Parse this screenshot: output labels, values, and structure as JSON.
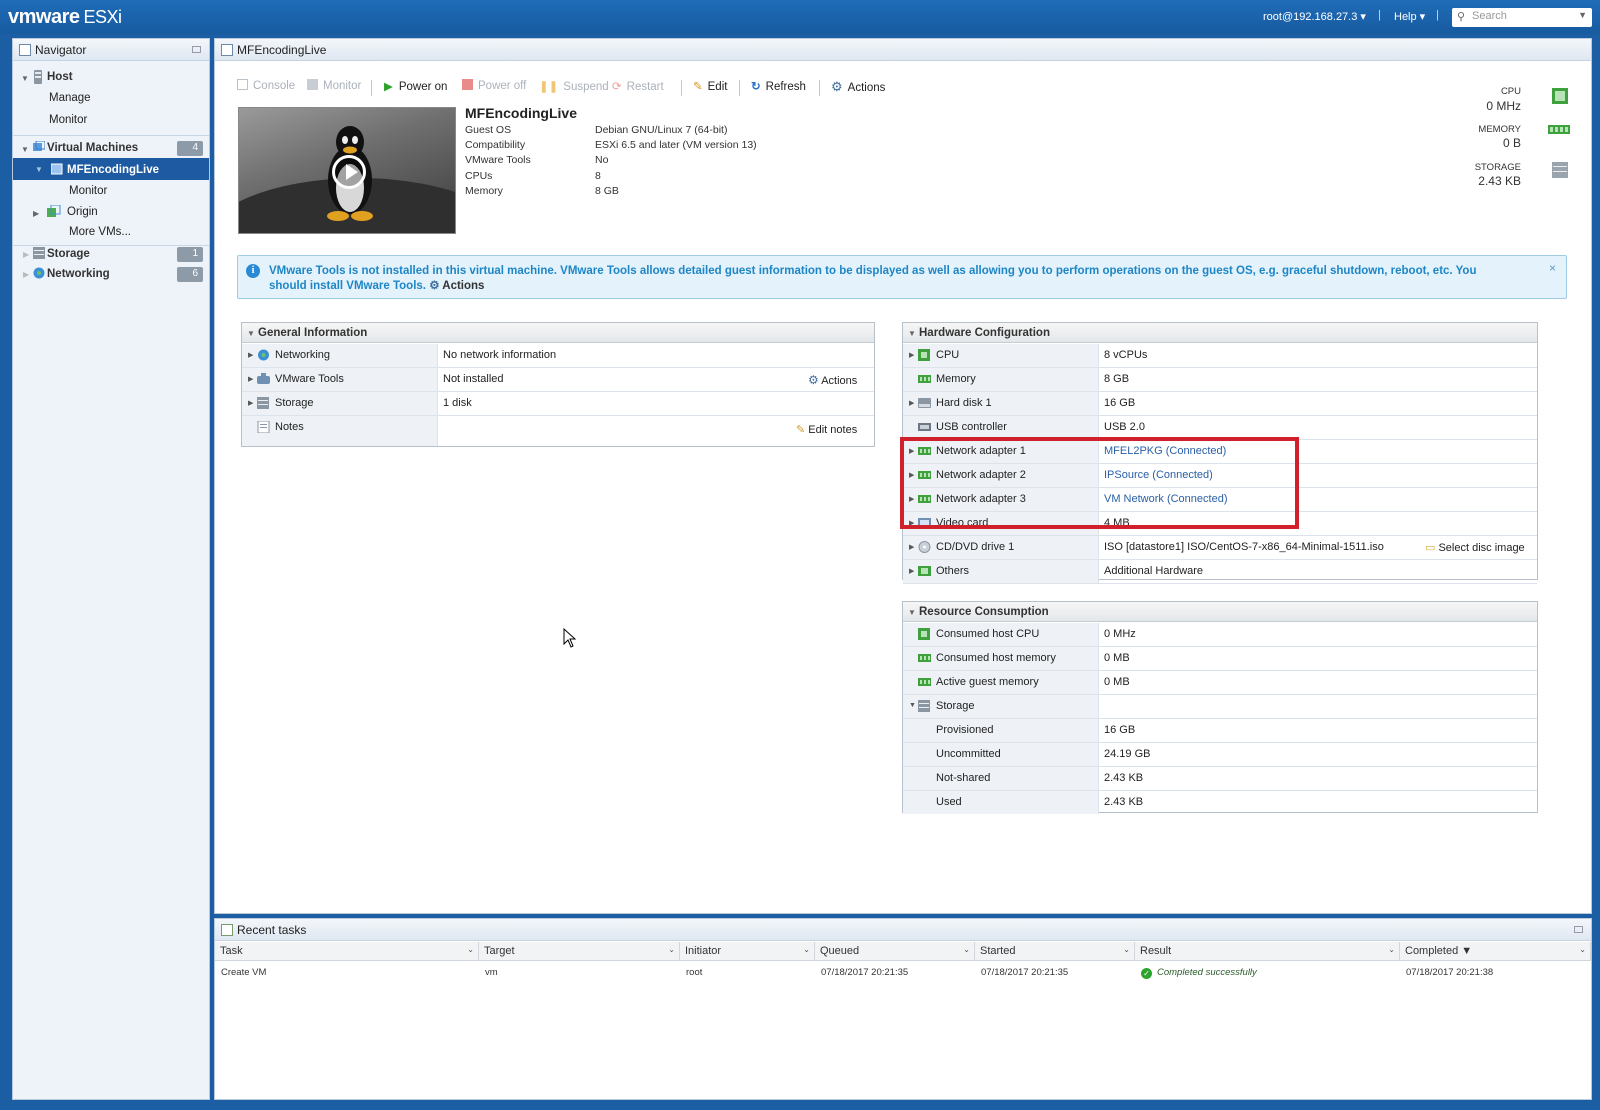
{
  "topbar": {
    "logo_vm": "vmware",
    "logo_product": "ESXi",
    "user": "root@192.168.27.3",
    "help": "Help",
    "search_placeholder": "Search"
  },
  "navigator": {
    "title": "Navigator",
    "host": "Host",
    "manage": "Manage",
    "monitor": "Monitor",
    "virtual_machines": "Virtual Machines",
    "vm_count": "4",
    "selected_vm": "MFEncodingLive",
    "vm_monitor": "Monitor",
    "origin": "Origin",
    "more_vms": "More VMs...",
    "storage": "Storage",
    "storage_count": "1",
    "networking": "Networking",
    "networking_count": "6"
  },
  "main": {
    "title": "MFEncodingLive",
    "toolbar": {
      "console": "Console",
      "monitor": "Monitor",
      "power_on": "Power on",
      "power_off": "Power off",
      "suspend": "Suspend",
      "restart": "Restart",
      "edit": "Edit",
      "refresh": "Refresh",
      "actions": "Actions"
    },
    "vm": {
      "name": "MFEncodingLive",
      "props": [
        {
          "label": "Guest OS",
          "value": "Debian GNU/Linux 7 (64-bit)"
        },
        {
          "label": "Compatibility",
          "value": "ESXi 6.5 and later (VM version 13)"
        },
        {
          "label": "VMware Tools",
          "value": "No"
        },
        {
          "label": "CPUs",
          "value": "8"
        },
        {
          "label": "Memory",
          "value": "8 GB"
        }
      ]
    },
    "stats": {
      "cpu_label": "CPU",
      "cpu_value": "0 MHz",
      "memory_label": "MEMORY",
      "memory_value": "0 B",
      "storage_label": "STORAGE",
      "storage_value": "2.43 KB"
    },
    "info": {
      "text": "VMware Tools is not installed in this virtual machine. VMware Tools allows detailed guest information to be displayed as well as allowing you to perform operations on the guest OS, e.g. graceful shutdown, reboot, etc. You should install VMware Tools.",
      "actions": "Actions",
      "close": "×"
    },
    "general": {
      "title": "General Information",
      "rows": [
        {
          "label": "Networking",
          "value": "No network information"
        },
        {
          "label": "VMware Tools",
          "value": "Not installed",
          "action": "Actions"
        },
        {
          "label": "Storage",
          "value": "1 disk"
        },
        {
          "label": "Notes",
          "value": "",
          "action": "Edit notes"
        }
      ]
    },
    "hardware": {
      "title": "Hardware Configuration",
      "rows": [
        {
          "label": "CPU",
          "value": "8 vCPUs"
        },
        {
          "label": "Memory",
          "value": "8 GB"
        },
        {
          "label": "Hard disk 1",
          "value": "16 GB"
        },
        {
          "label": "USB controller",
          "value": "USB 2.0"
        },
        {
          "label": "Network adapter 1",
          "value": "MFEL2PKG (Connected)"
        },
        {
          "label": "Network adapter 2",
          "value": "IPSource (Connected)"
        },
        {
          "label": "Network adapter 3",
          "value": "VM Network (Connected)"
        },
        {
          "label": "Video card",
          "value": "4 MB"
        },
        {
          "label": "CD/DVD drive 1",
          "value": "ISO [datastore1] ISO/CentOS-7-x86_64-Minimal-1511.iso",
          "action": "Select disc image"
        },
        {
          "label": "Others",
          "value": "Additional Hardware"
        }
      ]
    },
    "resources": {
      "title": "Resource Consumption",
      "rows": [
        {
          "label": "Consumed host CPU",
          "value": "0 MHz"
        },
        {
          "label": "Consumed host memory",
          "value": "0 MB"
        },
        {
          "label": "Active guest memory",
          "value": "0 MB"
        },
        {
          "label": "Storage",
          "value": ""
        },
        {
          "label": "Provisioned",
          "value": "16 GB"
        },
        {
          "label": "Uncommitted",
          "value": "24.19 GB"
        },
        {
          "label": "Not-shared",
          "value": "2.43 KB"
        },
        {
          "label": "Used",
          "value": "2.43 KB"
        }
      ]
    }
  },
  "tasks": {
    "title": "Recent tasks",
    "columns": [
      "Task",
      "Target",
      "Initiator",
      "Queued",
      "Started",
      "Result",
      "Completed ▼"
    ],
    "rows": [
      {
        "task": "Create VM",
        "target": "vm",
        "initiator": "root",
        "queued": "07/18/2017 20:21:35",
        "started": "07/18/2017 20:21:35",
        "result": "Completed successfully",
        "completed": "07/18/2017 20:21:38"
      }
    ]
  },
  "colors": {
    "topbar": "#1f6cb8",
    "selection": "#1d5aa1",
    "highlight_box": "#d0202c",
    "link": "#2a5fa5",
    "info_text": "#1e86c6"
  }
}
